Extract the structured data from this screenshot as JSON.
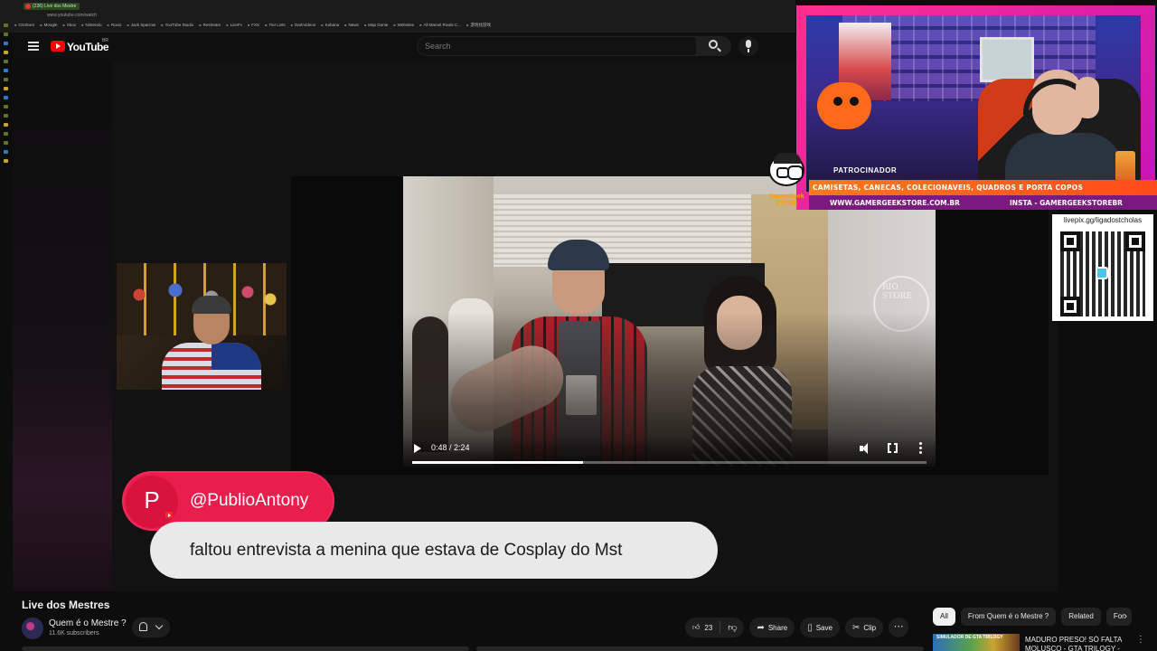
{
  "browser": {
    "tab_title": "(236) Live dos Mestre",
    "url": "www.youtube.com/watch",
    "bookmarks": [
      "GGStore",
      "Moogle",
      "Xbox",
      "Nintendo",
      "Roxio",
      "Jack Sparrow",
      "YouTube Studio",
      "Restream",
      "LiveFx",
      "FXS",
      "Tier Lists",
      "DarkVideos",
      "Kabana",
      "News",
      "Map Genie",
      "Websites",
      "All Marvel Rivals C...",
      "游戏找游戏"
    ]
  },
  "masthead": {
    "logo_text": "YouTube",
    "country_code": "BR",
    "search_placeholder": "Search"
  },
  "player": {
    "current_time": "0:48",
    "duration": "2:24",
    "time_display": "0:48 / 2:24",
    "progress_fraction": 0.333,
    "watermark_text": "RIO STORE"
  },
  "comment": {
    "avatar_letter": "P",
    "username": "@PublioAntony",
    "text": "faltou entrevista a menina que estava de Cosplay do Mst"
  },
  "video": {
    "title": "Live dos Mestres",
    "channel_name": "Quem é o Mestre ?",
    "subscribers": "11.6K subscribers",
    "likes": "23",
    "share_label": "Share",
    "save_label": "Save",
    "clip_label": "Clip"
  },
  "chips": {
    "items": [
      "All",
      "From Quem é o Mestre ?",
      "Related",
      "For"
    ]
  },
  "recommendation": {
    "thumb_text": "SIMULADOR DE GTA TRILOGY",
    "title": "MADURO PRESO! SÓ FALTA MOLUSCO - GTA TRILOGY -"
  },
  "overlay": {
    "sponsor_label": "PATROCINADOR",
    "sponsor_items": "CAMISETAS, CANECAS, COLECIONAVEIS, QUADROS E PORTA COPOS",
    "sponsor_site": "WWW.GAMERGEEKSTORE.COM.BR",
    "sponsor_insta": "INSTA - GAMERGEEKSTOREBR",
    "store_name": "GamerGeek STORE",
    "qr_url": "livepix.gg/ligadostcholas"
  },
  "colors": {
    "youtube_red": "#ff0000",
    "comment_pill": "#e91e4d",
    "frame_pink": "#ff2f8e",
    "sponsor_orange": "#ff5a1a"
  }
}
